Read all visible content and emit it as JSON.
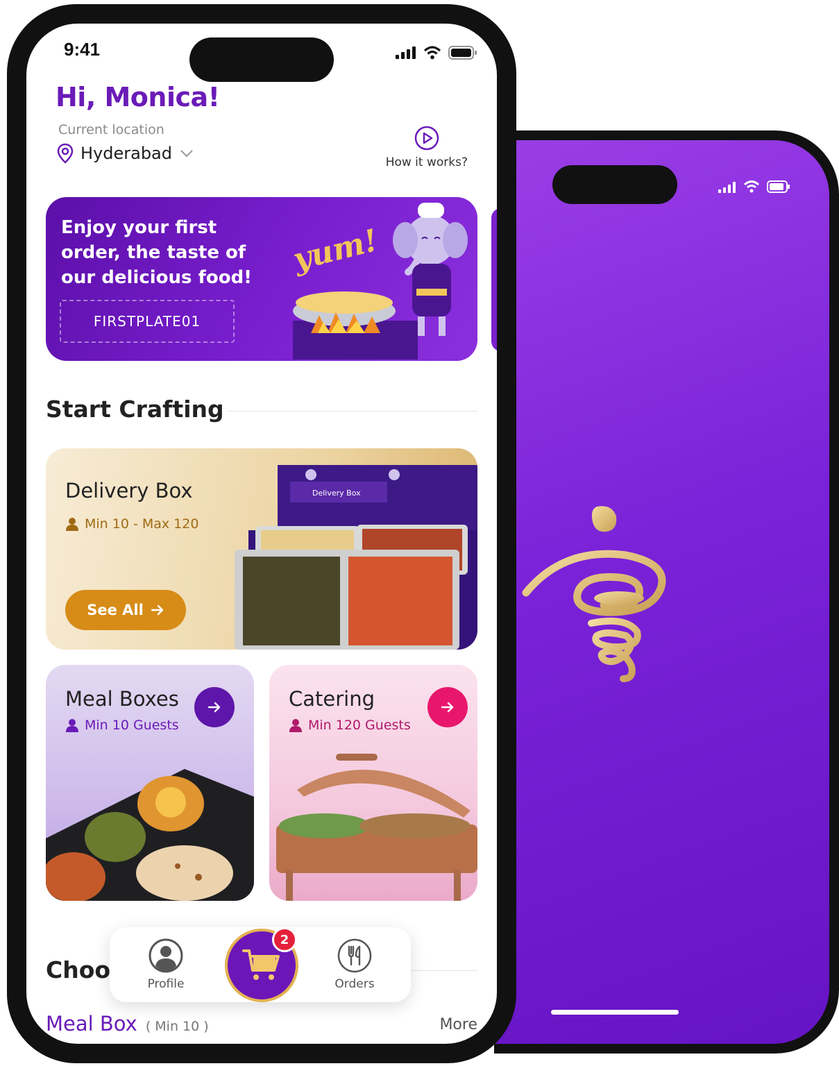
{
  "status_bar": {
    "time": "9:41"
  },
  "header": {
    "greeting": "Hi, Monica!",
    "location_label": "Current location",
    "location_city": "Hyderabad",
    "how_it_works": "How it works?"
  },
  "promo": {
    "text": "Enjoy your first order, the taste of our delicious food!",
    "code": "FIRSTPLATE01",
    "art_caption": "yum!"
  },
  "start_crafting": {
    "title": "Start Crafting",
    "delivery_box": {
      "title": "Delivery Box",
      "subtitle": "Min 10 - Max 120",
      "button": "See All",
      "box_label": "Delivery Box"
    },
    "meal_boxes": {
      "title": "Meal Boxes",
      "subtitle": "Min 10 Guests"
    },
    "catering": {
      "title": "Catering",
      "subtitle": "Min 120 Guests"
    }
  },
  "choose": {
    "title_partial": "Choo",
    "meal_box": "Meal Box",
    "meal_box_min": "( Min 10 )",
    "more": "More"
  },
  "bottom_nav": {
    "profile": "Profile",
    "orders": "Orders",
    "cart_count": "2"
  },
  "colors": {
    "brand_purple": "#6a1bb8",
    "accent_gold": "#d78c17",
    "catering_pink": "#e8176d",
    "badge_red": "#e5203a"
  }
}
